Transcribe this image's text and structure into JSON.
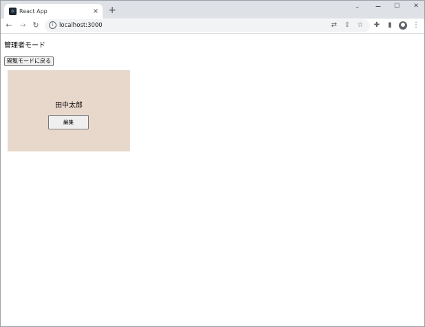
{
  "browser": {
    "tab": {
      "title": "React App",
      "favicon": "react-logo-icon"
    },
    "address": {
      "url": "localhost:3000"
    },
    "icons": {
      "close_tab": "×",
      "new_tab": "+",
      "tab_search": "⌄",
      "minimize": "−",
      "maximize": "☐",
      "close_window": "✕",
      "back": "←",
      "forward": "→",
      "reload": "↻",
      "info": "i",
      "translate": "⇄",
      "share": "⇪",
      "bookmark": "☆",
      "extensions": "✚",
      "side_panel": "▮",
      "menu": "⋮"
    }
  },
  "page": {
    "title": "管理者モード",
    "back_button_label": "閲覧モードに戻る",
    "card": {
      "name": "田中太郎",
      "edit_button_label": "編集",
      "background_color": "#e8d8cc"
    }
  }
}
